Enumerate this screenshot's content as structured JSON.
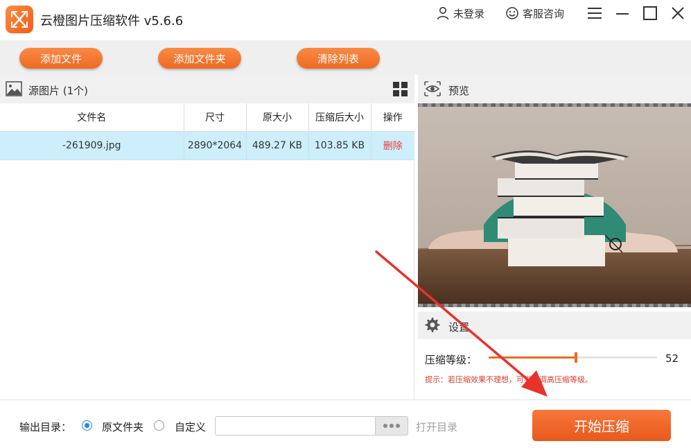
{
  "app": {
    "title": "云橙图片压缩软件 v5.6.6",
    "login": "未登录",
    "service": "客服咨询"
  },
  "toolbar": {
    "add_file": "添加文件",
    "add_folder": "添加文件夹",
    "clear_list": "清除列表"
  },
  "source": {
    "title": "源图片 (1个)",
    "columns": [
      "文件名",
      "尺寸",
      "原大小",
      "压缩后大小",
      "操作"
    ],
    "rows": [
      {
        "name": "-261909.jpg",
        "size": "2890*2064",
        "original": "489.27 KB",
        "compressed": "103.85 KB",
        "action": "删除"
      }
    ]
  },
  "preview": {
    "title": "预览"
  },
  "settings": {
    "title": "设置",
    "level_label": "压缩等级：",
    "level_value": "52",
    "level_fraction": 0.52,
    "tip": "提示：若压缩效果不理想，可尝试调高压缩等级。"
  },
  "output": {
    "label": "输出目录：",
    "option_original": "原文件夹",
    "option_custom": "自定义",
    "path_value": "",
    "open_dir": "打开目录",
    "start": "开始压缩"
  },
  "colors": {
    "accent": "#ee6a23",
    "selected_row": "#cdeefb",
    "tip": "#d43c2c",
    "arrow": "#e8322a"
  }
}
